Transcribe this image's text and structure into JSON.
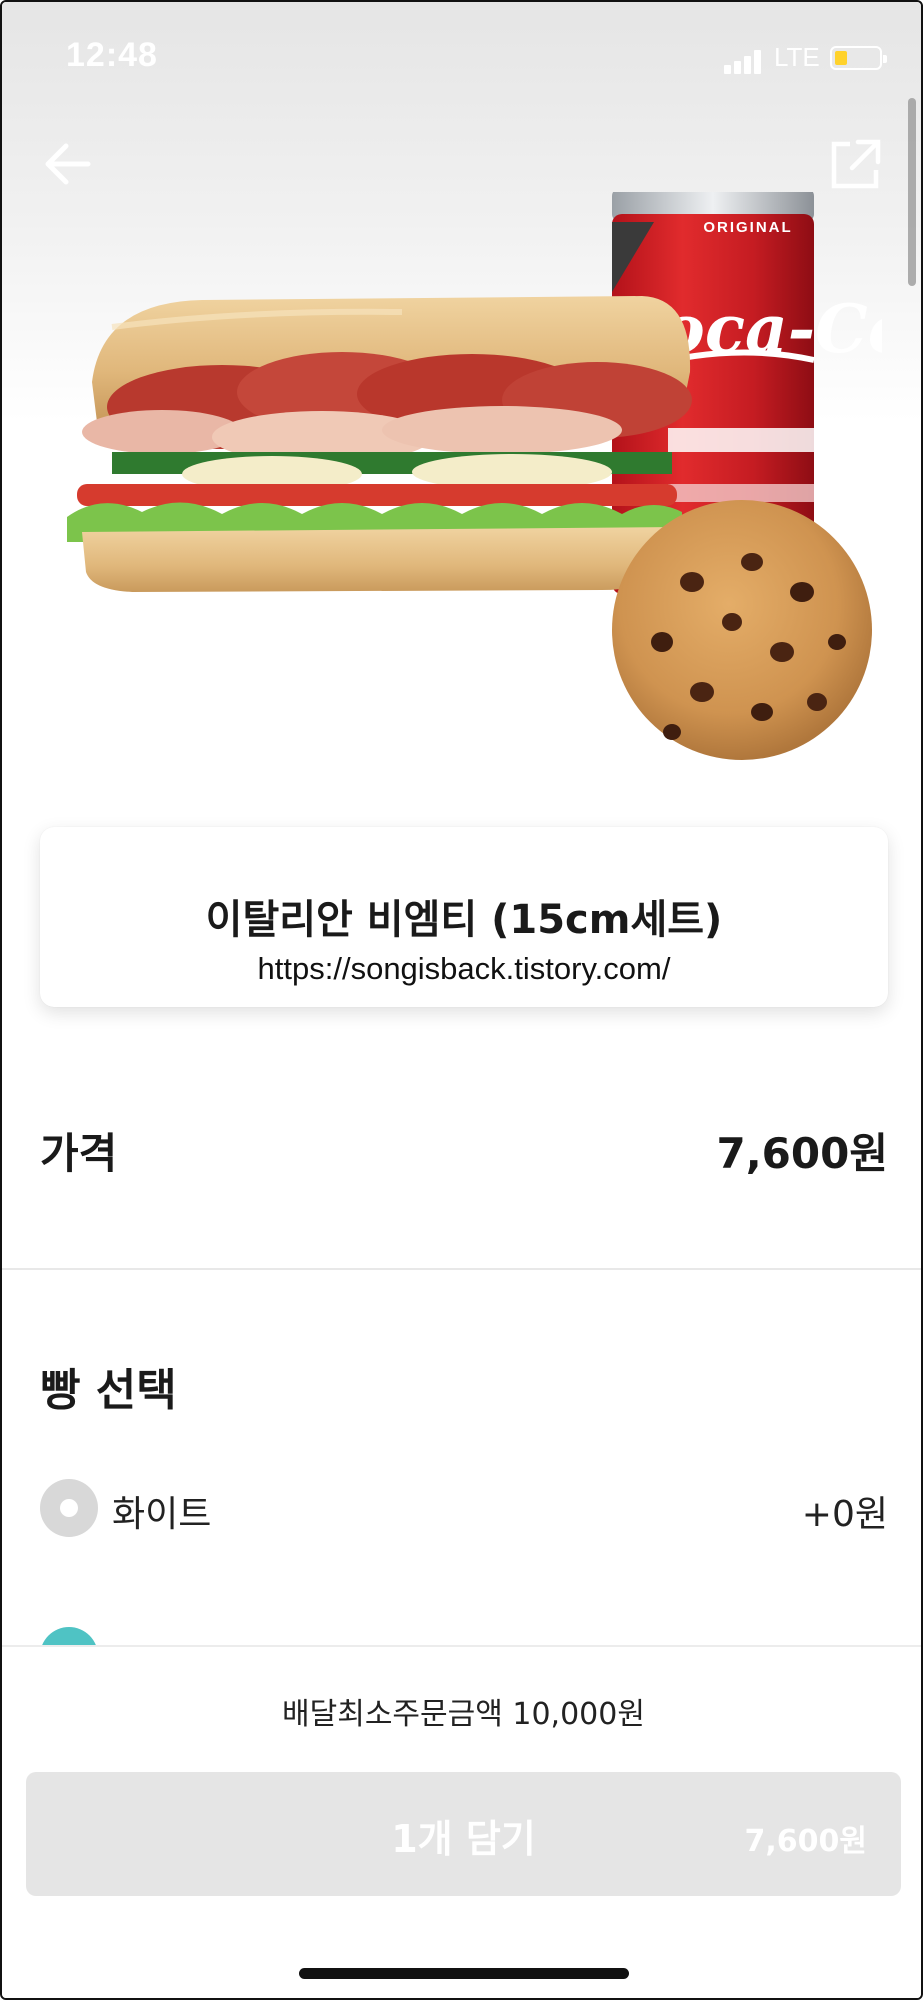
{
  "status_bar": {
    "time": "12:48",
    "network": "LTE"
  },
  "header": {
    "back_icon": "arrow-left-icon",
    "share_icon": "share-icon"
  },
  "product": {
    "image_alt": "sub sandwich, Coca-Cola can and chocolate chip cookie set",
    "can_brand": "Coca-Cola",
    "can_label": "ORIGINAL",
    "name": "이탈리안 비엠티 (15cm세트)",
    "watermark_url": "https://songisback.tistory.com/"
  },
  "price": {
    "label": "가격",
    "value": "7,600원"
  },
  "bread_section": {
    "title": "빵 선택",
    "options": [
      {
        "label": "화이트",
        "price": "+0원"
      }
    ]
  },
  "bottom": {
    "min_order": "배달최소주문금액 10,000원",
    "add_button_label": "1개 담기",
    "add_button_price": "7,600원"
  },
  "colors": {
    "accent_teal": "#4fc3c4",
    "button_disabled": "#e5e5e5",
    "text_dark": "#1a1a1a"
  }
}
